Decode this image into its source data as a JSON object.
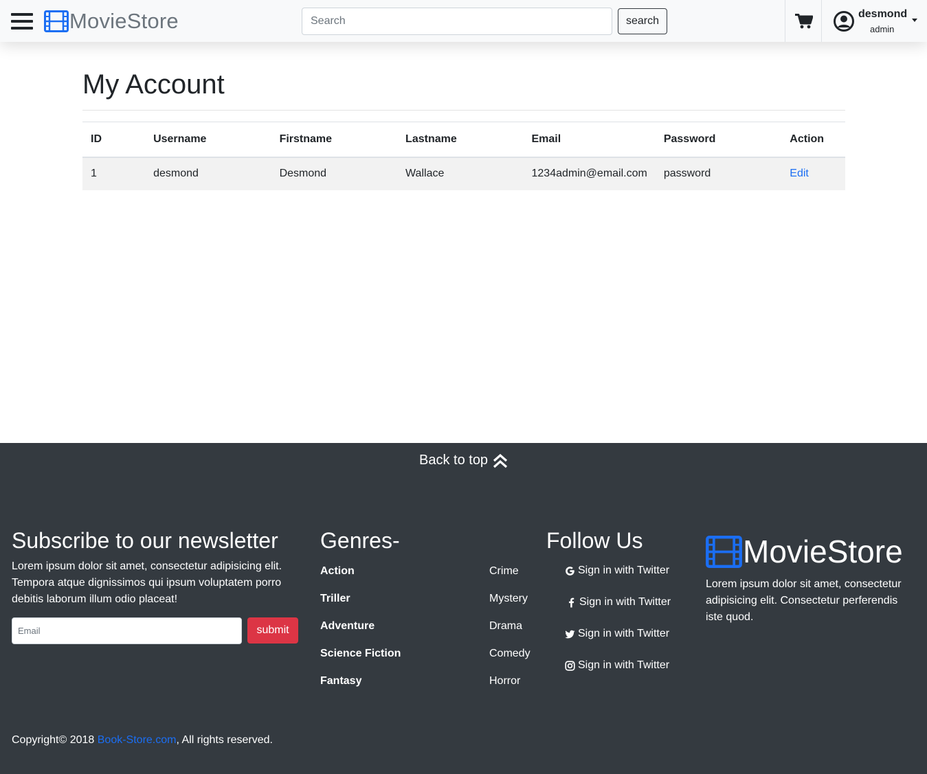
{
  "navbar": {
    "brand": "MovieStore",
    "search_placeholder": "Search",
    "search_button": "search",
    "user": {
      "name": "desmond",
      "role": "admin"
    }
  },
  "main": {
    "title": "My Account",
    "table": {
      "headers": [
        "ID",
        "Username",
        "Firstname",
        "Lastname",
        "Email",
        "Password",
        "Action"
      ],
      "rows": [
        {
          "id": "1",
          "username": "desmond",
          "firstname": "Desmond",
          "lastname": "Wallace",
          "email": "1234admin@email.com",
          "password": "password",
          "action": "Edit"
        }
      ]
    }
  },
  "footer": {
    "back_to_top": "Back to top",
    "newsletter": {
      "title": "Subscribe to our newsletter",
      "text": "Lorem ipsum dolor sit amet, consectetur adipisicing elit. Tempora atque dignissimos qui ipsum voluptatem porro debitis laborum illum odio placeat!",
      "email_placeholder": "Email",
      "submit": "submit"
    },
    "genres": {
      "title": "Genres-",
      "col1": [
        "Action",
        "Triller",
        "Adventure",
        "Science Fiction",
        "Fantasy"
      ],
      "col2": [
        "Crime",
        "Mystery",
        "Drama",
        "Comedy",
        "Horror"
      ]
    },
    "follow": {
      "title": "Follow Us",
      "items": [
        {
          "icon": "google-icon",
          "label": "Sign in with Twitter"
        },
        {
          "icon": "facebook-icon",
          "label": "Sign in with Twitter"
        },
        {
          "icon": "twitter-icon",
          "label": "Sign in with Twitter"
        },
        {
          "icon": "instagram-icon",
          "label": "Sign in with Twitter"
        }
      ]
    },
    "brand": "MovieStore",
    "brand_text": "Lorem ipsum dolor sit amet, consectetur adipisicing elit. Consectetur perferendis iste quod.",
    "copyright_prefix": "Copyright© 2018 ",
    "copyright_link": "Book-Store.com",
    "copyright_suffix": ", All rights reserved."
  },
  "colors": {
    "accent": "#1b6ef3",
    "footer_bg": "#343a40",
    "danger": "#dc3545"
  }
}
